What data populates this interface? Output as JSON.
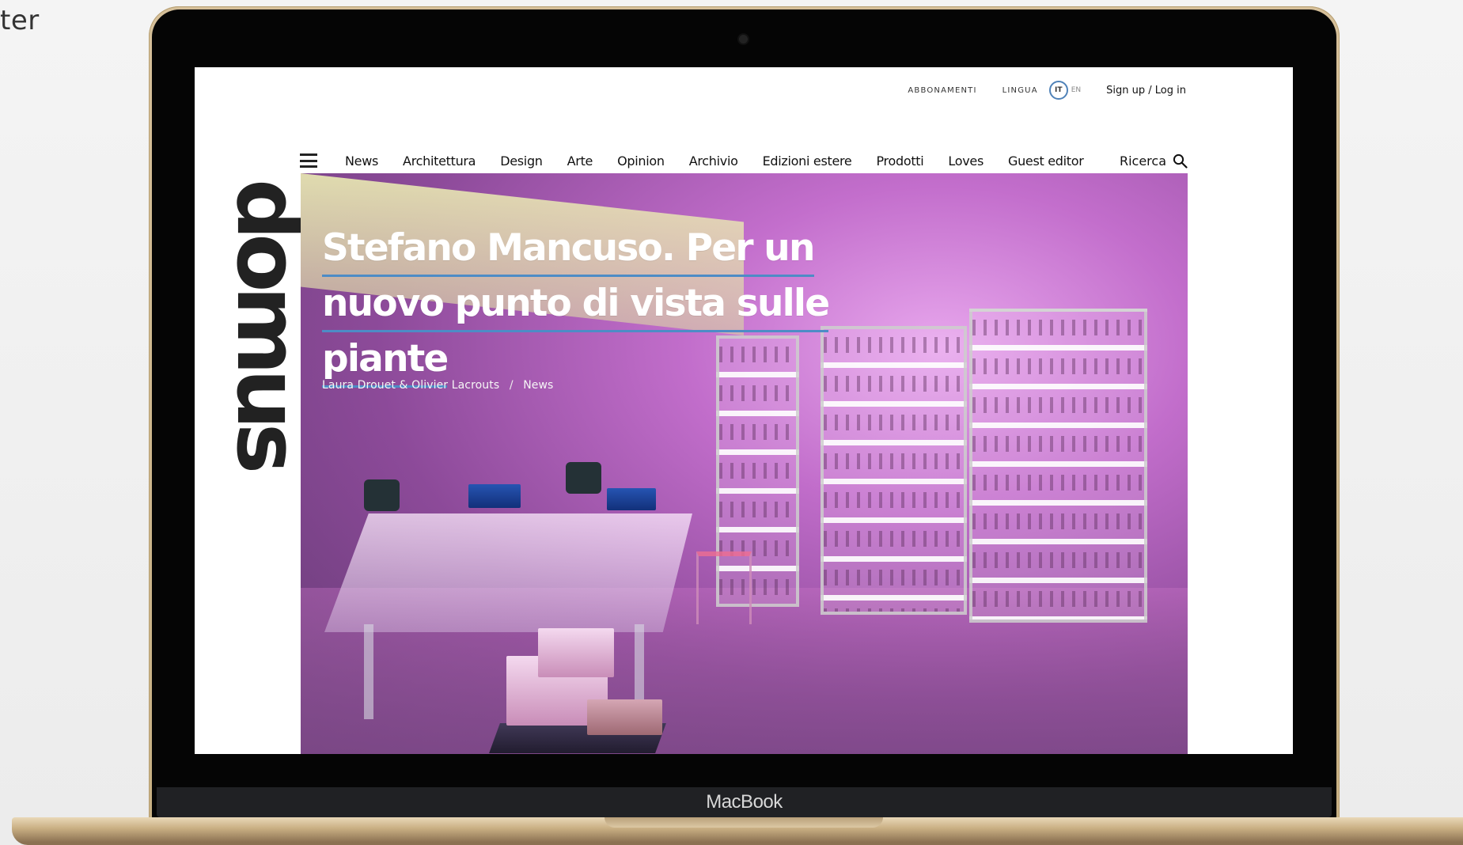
{
  "page": {
    "corner_text": "ter"
  },
  "device": {
    "label": "MacBook"
  },
  "site": {
    "topbar": {
      "subscriptions": "ABBONAMENTI",
      "language_label": "LINGUA",
      "language_active": "IT",
      "language_other": "EN",
      "auth": "Sign up / Log in"
    },
    "nav": {
      "items": [
        "News",
        "Architettura",
        "Design",
        "Arte",
        "Opinion",
        "Archivio",
        "Edizioni estere",
        "Prodotti",
        "Loves",
        "Guest editor"
      ],
      "search_label": "Ricerca",
      "menu_icon": "hamburger-menu-icon",
      "search_icon": "search-icon"
    },
    "logo": "domus",
    "hero": {
      "title_lines": [
        "Stefano Mancuso. Per un",
        "nuovo punto di vista sulle",
        "piante"
      ],
      "authors": "Laura Drouet & Olivier Lacrouts",
      "separator": "/",
      "category": "News",
      "accent_color": "#4d8cc6",
      "image_tint": "#b86cc3"
    }
  }
}
